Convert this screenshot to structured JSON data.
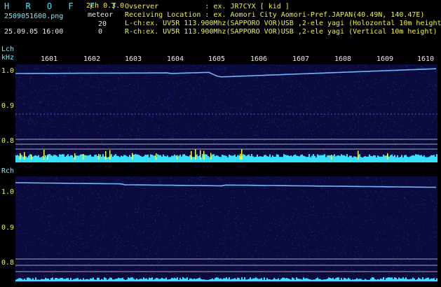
{
  "header": {
    "app_title": "H R O F F T",
    "version": "2ch 0.3.0",
    "filename": "2509051600.png",
    "datetime": "25.09.05 16:00",
    "counter_label": "meteor",
    "lch_count": "20",
    "rch_count": "0",
    "observer_line": "Ovserver           : ex. JR7CYX [ kid ]",
    "location_line": "Receiving Location : ex. Aomori City Aomori-Pref.JAPAN(40.49N, 140.47E)",
    "lch_line": "L-ch:ex. UV5R 113.900Mhz(SAPPORO VOR)USB ,2-ele yagi (Holozontal 10m height)",
    "rch_line": "R-ch:ex. UV5R 113.900Mhz(SAPPORO VOR)USB ,2-ele yagi (Vertical 10m height)"
  },
  "lch": {
    "label": "Lch",
    "unit": "kHz",
    "time_ticks": [
      "1601",
      "1602",
      "1603",
      "1604",
      "1605",
      "1606",
      "1607",
      "1608",
      "1609",
      "1610"
    ],
    "freq_ticks": [
      "1.0",
      "0.9",
      "0.8"
    ]
  },
  "rch": {
    "label": "Rch",
    "freq_ticks": [
      "1.0",
      "0.9",
      "0.8"
    ]
  },
  "colors": {
    "background": "#000000",
    "panel_bg": "#0a0a3c",
    "carrier": "#6fb7ff",
    "level_bar": "#36e0ff",
    "meteor_mark": "#f5ff3a",
    "grid_line": "#cfcfcf"
  }
}
